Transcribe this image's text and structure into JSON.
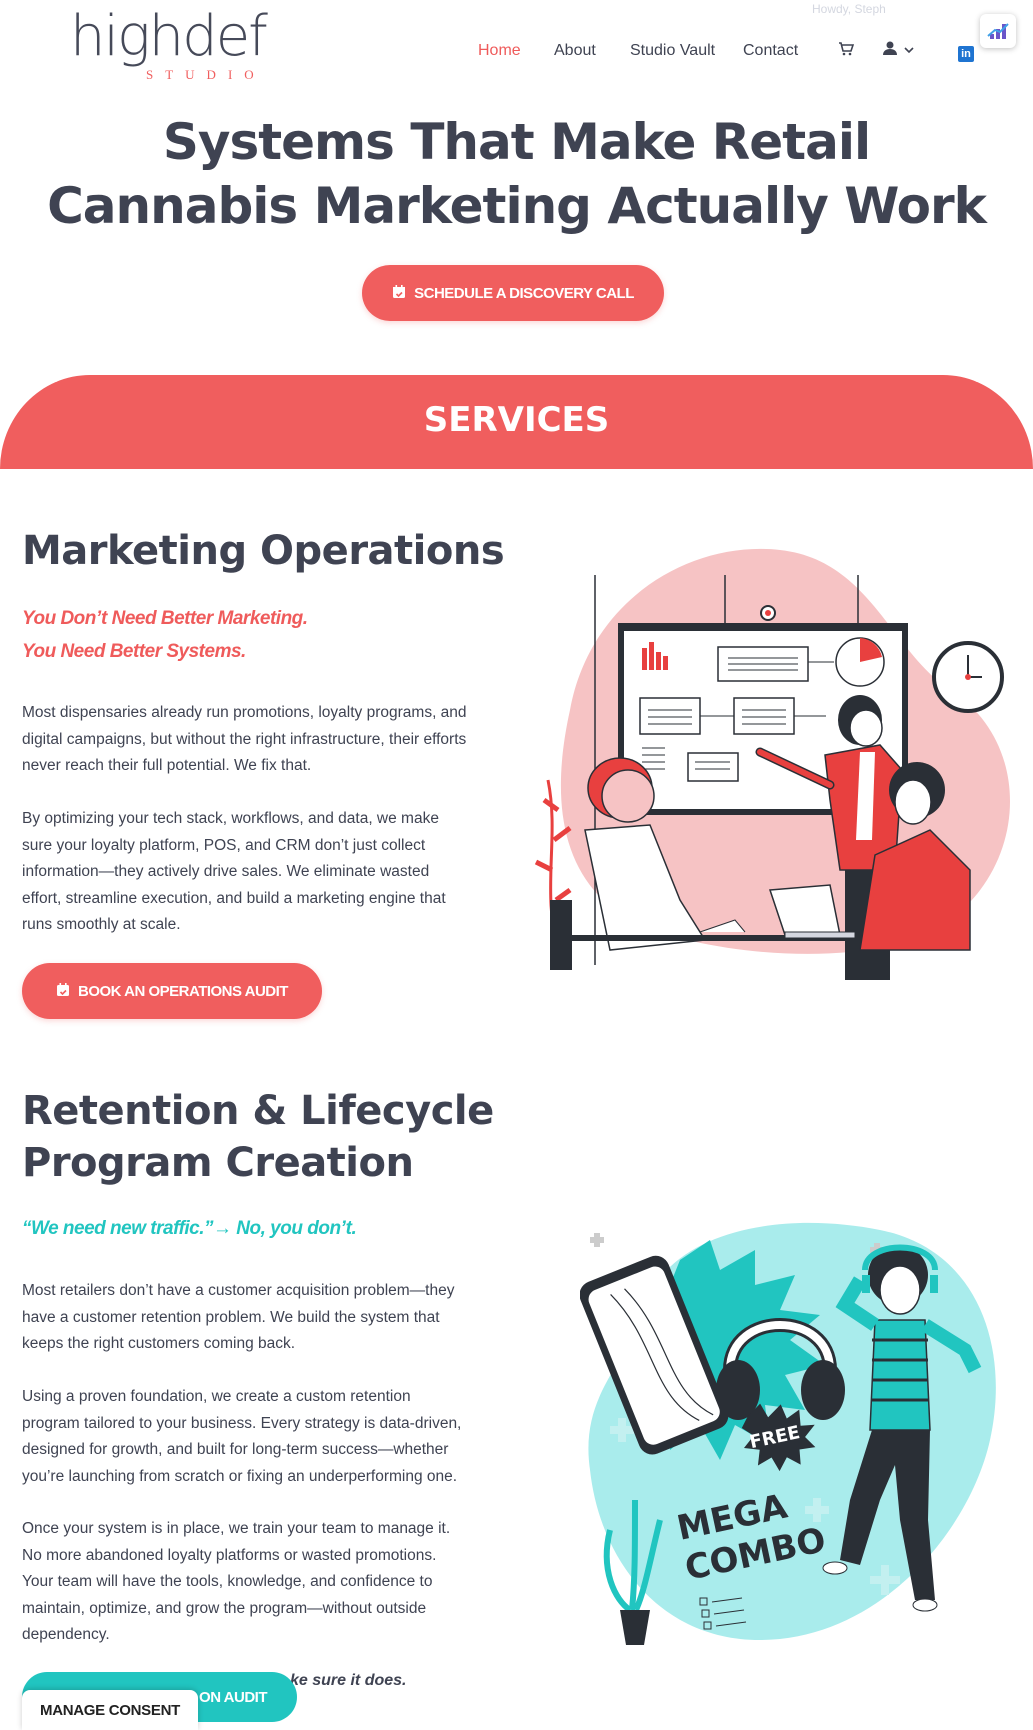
{
  "header": {
    "logo_main": "highdef",
    "logo_sub": "STUDIO",
    "admin_greeting": "Howdy, Steph",
    "nav": [
      {
        "label": "Home",
        "active": true
      },
      {
        "label": "About",
        "active": false
      },
      {
        "label": "Studio Vault",
        "active": false
      },
      {
        "label": "Contact",
        "active": false
      }
    ],
    "icons": {
      "cart": "cart-icon",
      "account": "user-icon",
      "dropdown": "chevron-down-icon",
      "social": "linkedin-icon"
    },
    "linkedin_glyph": "in"
  },
  "hero": {
    "title": "Systems That Make Retail Cannabis Marketing Actually Work",
    "cta": "SCHEDULE A DISCOVERY CALL"
  },
  "services": {
    "title": "SERVICES"
  },
  "marketing_ops": {
    "title": "Marketing Operations",
    "tagline_1": "You Don’t Need Better Marketing.",
    "tagline_2": "You Need Better Systems.",
    "para_1": "Most dispensaries already run promotions, loyalty programs, and digital campaigns, but without the right infrastructure, their efforts never reach their full potential. We fix that.",
    "para_2": "By optimizing your tech stack, workflows, and data, we make sure your loyalty platform, POS, and CRM don’t just collect information—they actively drive sales. We eliminate wasted effort, streamline execution, and build a marketing engine that runs smoothly at scale.",
    "cta": "BOOK AN OPERATIONS AUDIT"
  },
  "retention": {
    "title_1": "Retention & Lifecycle",
    "title_2": "Program Creation",
    "tagline": "“We need new traffic.”→ No, you don’t.",
    "para_1": "Most retailers don’t have a customer acquisition problem—they have a customer retention problem. We build the system that keeps the right customers coming back.",
    "para_2": "Using a proven foundation, we create a custom retention program tailored to your business. Every strategy is data-driven, designed for growth, and built for long-term success—whether you’re launching from scratch or fixing an underperforming one.",
    "para_3": "Once your system is in place, we train your team to manage it. No more abandoned loyalty platforms or wasted promotions. Your team will have the tools, knowledge, and confidence to maintain, optimize, and grow the program—without outside dependency.",
    "partial_text": "ke sure it does.",
    "cta_partial": "ON AUDIT",
    "illustration_text_1": "FREE",
    "illustration_text_2": "MEGA",
    "illustration_text_3": "COMBO"
  },
  "cookie": {
    "label": "MANAGE CONSENT"
  },
  "colors": {
    "accent": "#f05e5e",
    "teal": "#21c5c0",
    "text": "#3f4352"
  }
}
